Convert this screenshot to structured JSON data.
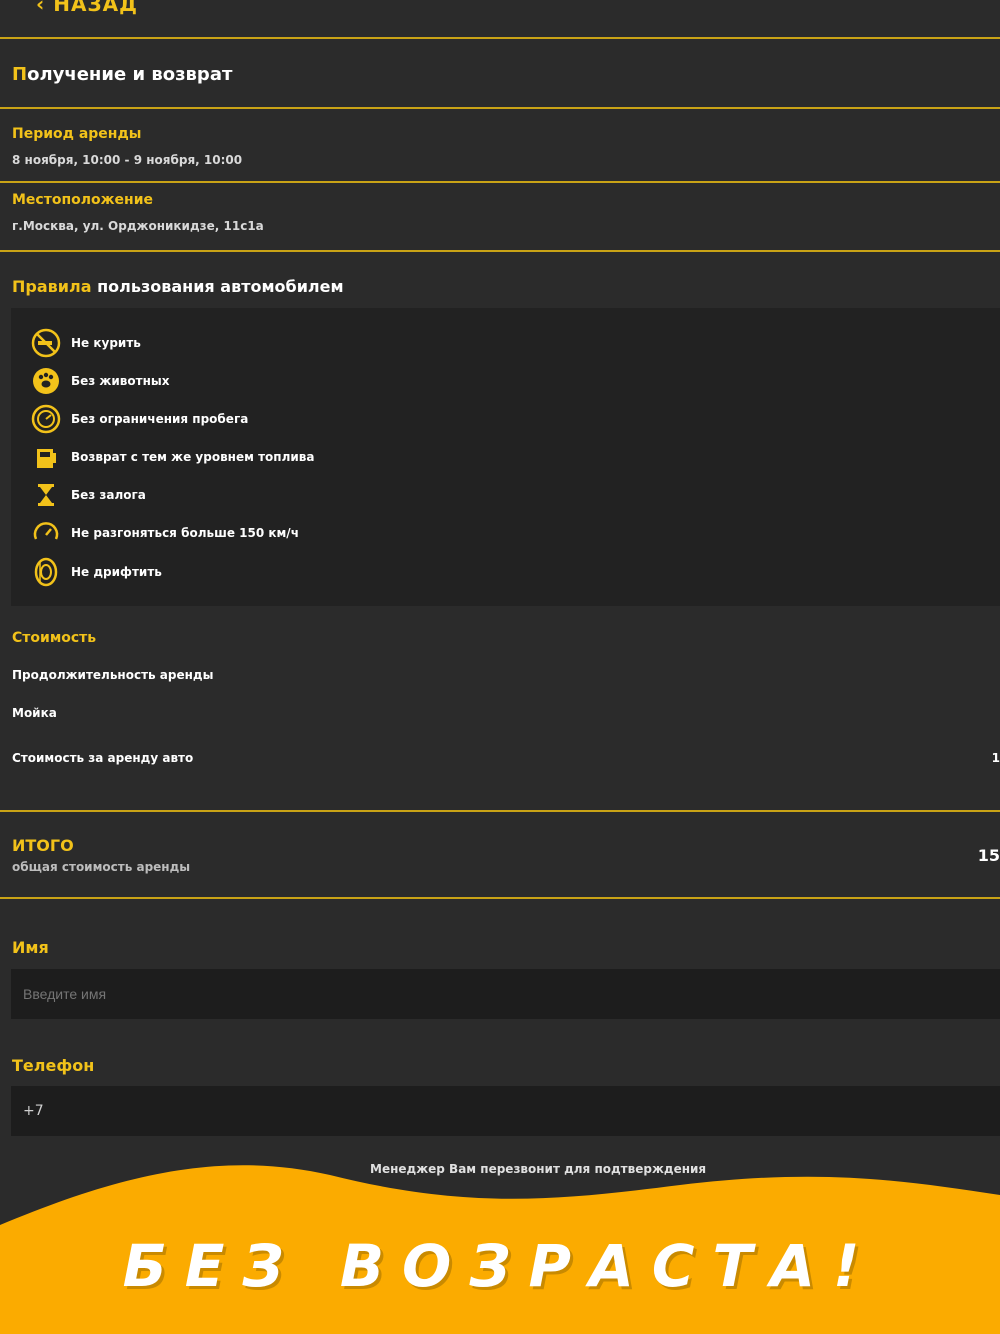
{
  "header": {
    "back_label": "НАЗАД"
  },
  "pickup": {
    "title_first": "П",
    "title_rest": "олучение и возврат"
  },
  "period": {
    "label": "Период аренды",
    "value": "8 ноября, 10:00 - 9 ноября, 10:00"
  },
  "location": {
    "label": "Местоположение",
    "value": "г.Москва, ул. Орджоникидзе, 11с1а"
  },
  "rules": {
    "title_accent": "Правила",
    "title_rest": " пользования автомобилем",
    "items": [
      {
        "icon": "no-smoking-icon",
        "label": "Не курить"
      },
      {
        "icon": "no-pets-icon",
        "label": "Без животных"
      },
      {
        "icon": "unlimited-mileage-icon",
        "label": "Без ограничения пробега"
      },
      {
        "icon": "fuel-icon",
        "label": "Возврат с тем же уровнем топлива"
      },
      {
        "icon": "hourglass-icon",
        "label": "Без залога"
      },
      {
        "icon": "speedometer-icon",
        "label": "Не разгоняться больше 150 км/ч"
      },
      {
        "icon": "tire-icon",
        "label": "Не дрифтить"
      }
    ]
  },
  "cost": {
    "label": "Стоимость",
    "duration_label": "Продолжительность аренды",
    "wash_label": "Мойка",
    "rent_label": "Стоимость за аренду авто",
    "rent_value": "1"
  },
  "total": {
    "label": "ИТОГО",
    "sublabel": "общая стоимость аренды",
    "value": "15"
  },
  "form": {
    "name_label": "Имя",
    "name_placeholder": "Введите имя",
    "phone_label": "Телефон",
    "phone_value": "+7",
    "note": "Менеджер Вам перезвонит для подтверждения"
  },
  "banner": {
    "text": "БЕЗ ВОЗРАСТА!"
  },
  "colors": {
    "accent": "#f2c21a",
    "background": "#2b2b2b",
    "banner": "#fbab00"
  }
}
